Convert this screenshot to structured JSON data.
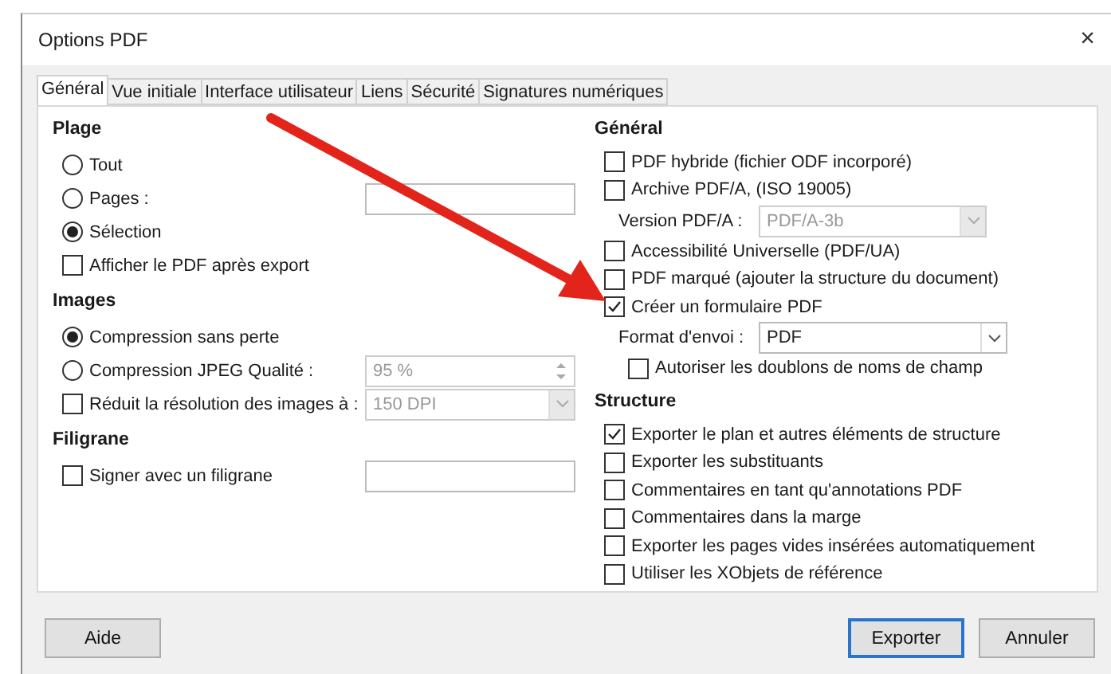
{
  "window": {
    "title": "Options PDF",
    "close": "×"
  },
  "tabs": [
    {
      "label": "Général",
      "selected": true
    },
    {
      "label": "Vue initiale",
      "selected": false
    },
    {
      "label": "Interface utilisateur",
      "selected": false
    },
    {
      "label": "Liens",
      "selected": false
    },
    {
      "label": "Sécurité",
      "selected": false
    },
    {
      "label": "Signatures numériques",
      "selected": false
    }
  ],
  "left_sections": [
    {
      "heading": "Plage",
      "items": [
        {
          "kind": "radio",
          "label": "Tout",
          "checked": false
        },
        {
          "kind": "radio",
          "label": "Pages :",
          "checked": false,
          "control": {
            "kind": "text",
            "disabled": false
          }
        },
        {
          "kind": "radio",
          "label": "Sélection",
          "checked": true
        },
        {
          "kind": "checkbox",
          "label": "Afficher le PDF après export",
          "checked": false
        }
      ]
    },
    {
      "heading": "Images",
      "items": [
        {
          "kind": "radio",
          "label": "Compression sans perte",
          "checked": true
        },
        {
          "kind": "radio",
          "label": "Compression JPEG  Qualité :",
          "checked": false,
          "control": {
            "kind": "spin",
            "value": "95 %",
            "disabled": true
          }
        },
        {
          "kind": "checkbox",
          "label": "Réduit la résolution des images à :",
          "checked": false,
          "control": {
            "kind": "combo",
            "value": "150 DPI",
            "disabled": true
          }
        }
      ]
    },
    {
      "heading": "Filigrane",
      "items": [
        {
          "kind": "checkbox",
          "label": "Signer avec un filigrane",
          "checked": false,
          "control": {
            "kind": "text",
            "disabled": false
          }
        }
      ]
    }
  ],
  "right_sections": [
    {
      "heading": "Général",
      "items": [
        {
          "kind": "checkbox",
          "label": "PDF hybride (fichier ODF incorporé)",
          "checked": false
        },
        {
          "kind": "checkbox",
          "label": "Archive PDF/A, (ISO 19005)",
          "checked": false,
          "children": [
            {
              "kind": "labeled_combo",
              "label": "Version PDF/A :",
              "value": "PDF/A-3b",
              "disabled": true
            }
          ]
        },
        {
          "kind": "checkbox",
          "label": "Accessibilité Universelle (PDF/UA)",
          "checked": false
        },
        {
          "kind": "checkbox",
          "label": "PDF marqué (ajouter la structure du document)",
          "checked": false
        },
        {
          "kind": "checkbox",
          "label": "Créer un formulaire PDF",
          "checked": true,
          "children": [
            {
              "kind": "labeled_combo",
              "label": "Format d'envoi :",
              "value": "PDF",
              "disabled": false
            },
            {
              "kind": "checkbox",
              "label": "Autoriser les doublons de noms de champ",
              "checked": false
            }
          ]
        }
      ]
    },
    {
      "heading": "Structure",
      "items": [
        {
          "kind": "checkbox",
          "label": "Exporter le plan et autres éléments de structure",
          "checked": true
        },
        {
          "kind": "checkbox",
          "label": "Exporter les substituants",
          "checked": false
        },
        {
          "kind": "checkbox",
          "label": "Commentaires en tant qu'annotations PDF",
          "checked": false
        },
        {
          "kind": "checkbox",
          "label": "Commentaires dans la marge",
          "checked": false
        },
        {
          "kind": "checkbox",
          "label": "Exporter les pages vides insérées automatiquement",
          "checked": false
        },
        {
          "kind": "checkbox",
          "label": "Utiliser les XObjets de référence",
          "checked": false
        }
      ]
    }
  ],
  "buttons_left": [
    {
      "label": "Aide",
      "default": false
    }
  ],
  "buttons_right": [
    {
      "label": "Exporter",
      "default": true
    },
    {
      "label": "Annuler",
      "default": false
    }
  ]
}
